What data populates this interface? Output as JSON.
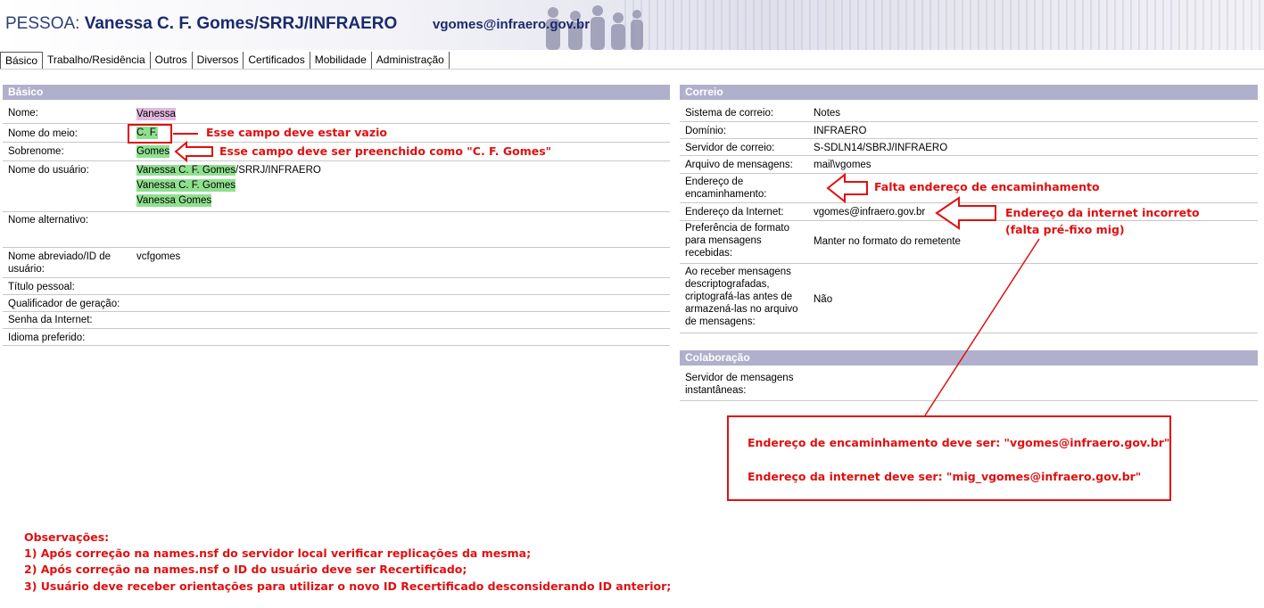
{
  "header": {
    "prefix": "PESSOA:",
    "name": "Vanessa C. F. Gomes/SRRJ/INFRAERO",
    "email": "vgomes@infraero.gov.br"
  },
  "tabs": [
    "Básico",
    "Trabalho/Residência",
    "Outros",
    "Diversos",
    "Certificados",
    "Mobilidade",
    "Administração"
  ],
  "basico": {
    "title": "Básico",
    "rows": [
      {
        "label": "Nome:",
        "value": "Vanessa"
      },
      {
        "label": "Nome do meio:",
        "value": "C. F."
      },
      {
        "label": "Sobrenome:",
        "value": "Gomes"
      },
      {
        "label": "Nome do usuário:",
        "values": [
          "Vanessa C. F. Gomes",
          "/SRRJ/INFRAERO",
          "Vanessa C. F. Gomes",
          "Vanessa Gomes"
        ]
      },
      {
        "label": "Nome alternativo:",
        "value": ""
      },
      {
        "label": "Nome abreviado/ID de usuário:",
        "value": "vcfgomes"
      },
      {
        "label": "Título pessoal:",
        "value": ""
      },
      {
        "label": "Qualificador de geração:",
        "value": ""
      },
      {
        "label": "Senha da Internet:",
        "value": ""
      },
      {
        "label": "Idioma preferido:",
        "value": ""
      }
    ]
  },
  "correio": {
    "title": "Correio",
    "rows": [
      {
        "label": "Sistema de correio:",
        "value": "Notes"
      },
      {
        "label": "Domínio:",
        "value": "INFRAERO"
      },
      {
        "label": "Servidor de correio:",
        "value": "S-SDLN14/SBRJ/INFRAERO"
      },
      {
        "label": "Arquivo de mensagens:",
        "value": "mail\\vgomes"
      },
      {
        "label": "Endereço de encaminhamento:",
        "value": ""
      },
      {
        "label": "Endereço da Internet:",
        "value": "vgomes@infraero.gov.br"
      },
      {
        "label": "Preferência de formato para mensagens recebidas:",
        "value": "Manter no formato do remetente"
      },
      {
        "label": "Ao receber mensagens descriptografadas, criptografá-las antes de armazená-las no arquivo de mensagens:",
        "value": "Não"
      }
    ]
  },
  "colaboracao": {
    "title": "Colaboração",
    "rows": [
      {
        "label": "Servidor de mensagens instantâneas:",
        "value": ""
      }
    ]
  },
  "annotations": {
    "nome_meio": "Esse campo deve estar vazio",
    "sobrenome": "Esse campo deve ser preenchido como \"C. F. Gomes\"",
    "encaminhamento": "Falta endereço de encaminhamento",
    "internet_line1": "Endereço da internet incorreto",
    "internet_line2": "(falta pré-fixo mig)",
    "box_line1": "Endereço de encaminhamento deve ser: \"vgomes@infraero.gov.br\"",
    "box_line2": "Endereço da internet deve ser: \"mig_vgomes@infraero.gov.br\"",
    "obs_title": "Observações:",
    "obs": [
      "1) Após correção na names.nsf do servidor local verificar replicações da mesma;",
      "2) Após correção na names.nsf o ID do usuário deve ser Recertificado;",
      "3) Usuário deve receber orientações para utilizar o novo ID Recertificado desconsiderando ID anterior;"
    ]
  },
  "colors": {
    "section_header": "#b0b0cc",
    "annotation_red": "#e01010",
    "highlight_green": "#8fe08f",
    "highlight_purple": "#e2b8e0"
  }
}
